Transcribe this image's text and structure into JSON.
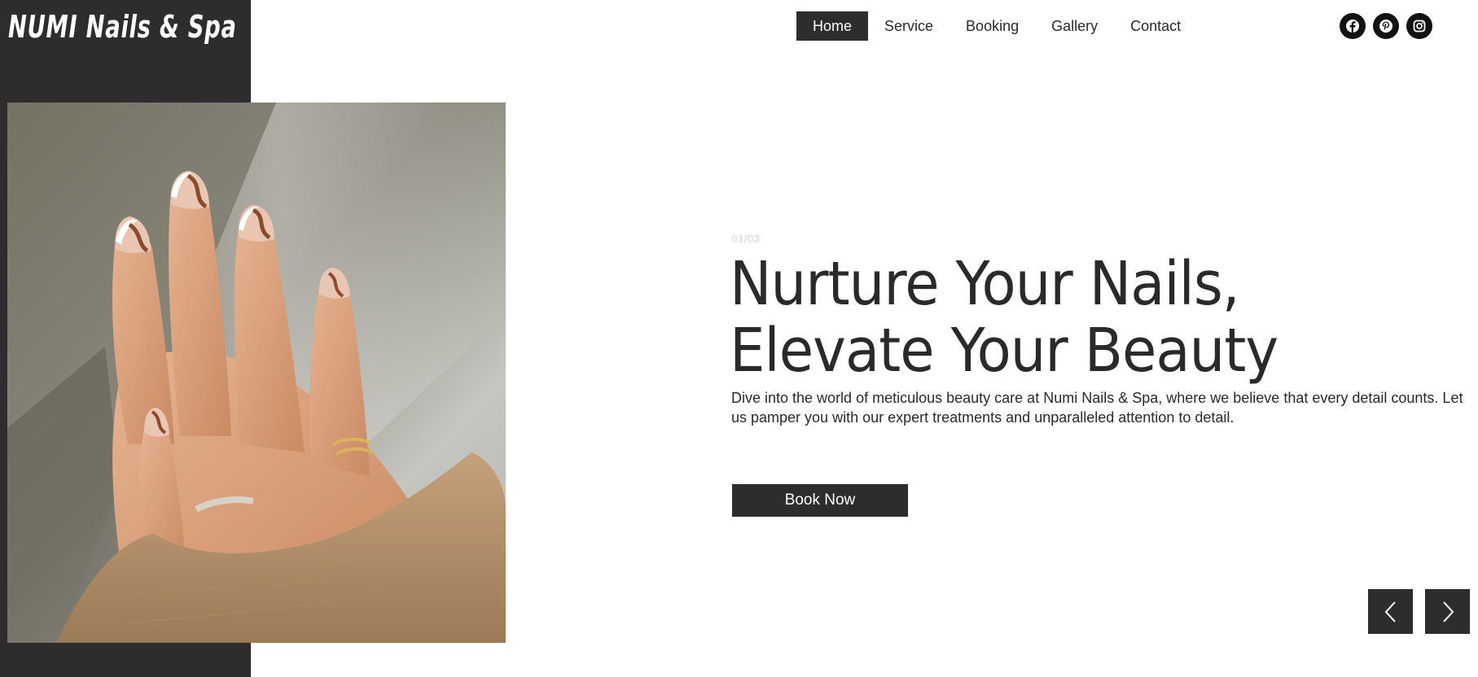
{
  "brand": {
    "logo_text": "NUMI Nails & Spa"
  },
  "nav": {
    "items": [
      {
        "label": "Home",
        "active": true
      },
      {
        "label": "Service",
        "active": false
      },
      {
        "label": "Booking",
        "active": false
      },
      {
        "label": "Gallery",
        "active": false
      },
      {
        "label": "Contact",
        "active": false
      }
    ]
  },
  "social": {
    "icons": [
      "facebook-icon",
      "pinterest-icon",
      "instagram-icon"
    ]
  },
  "hero": {
    "counter": "01/03",
    "headline_line1": "Nurture Your Nails,",
    "headline_line2": "Elevate Your Beauty",
    "description": "Dive into the world of meticulous beauty care at Numi Nails & Spa, where we believe that every detail counts. Let us pamper you with our expert treatments and unparalleled attention to detail.",
    "cta_label": "Book Now"
  },
  "slider": {
    "prev_icon": "chevron-left-icon",
    "next_icon": "chevron-right-icon"
  },
  "colors": {
    "dark": "#2f2c2d",
    "text": "#2b292a",
    "counter": "#e3e3e3",
    "white": "#ffffff"
  }
}
